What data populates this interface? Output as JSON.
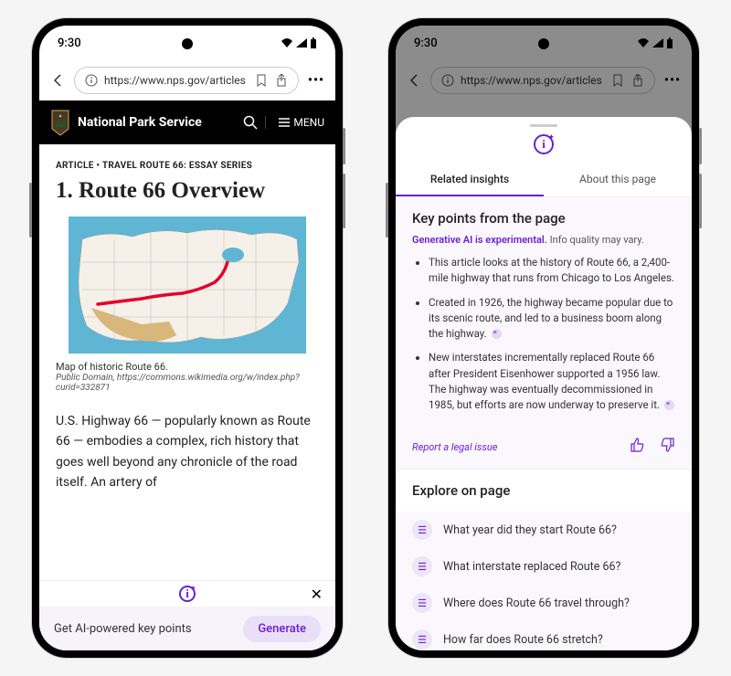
{
  "status": {
    "time": "9:30"
  },
  "browser": {
    "url": "https://www.nps.gov/articles",
    "menu_dots": "•••"
  },
  "nps": {
    "title": "National Park Service",
    "menu_label": "MENU"
  },
  "article": {
    "eyebrow": "ARTICLE • TRAVEL ROUTE 66: ESSAY SERIES",
    "headline": "1. Route 66 Overview",
    "caption": "Map of historic Route 66.",
    "caption_sub": "Public Domain, https://commons.wikimedia.org/w/index.php?curid=332871",
    "body": "U.S. Highway 66 — popularly known as Route 66 — embodies a complex, rich history that goes well beyond any chronicle of the road itself. An artery of"
  },
  "ai_bar": {
    "prompt": "Get AI-powered key points",
    "generate": "Generate"
  },
  "sheet": {
    "tabs": {
      "insights": "Related insights",
      "about": "About this page"
    },
    "key_points_title": "Key points from the page",
    "disclaimer_bold": "Generative AI is experimental.",
    "disclaimer_rest": " Info quality may vary.",
    "bullets": [
      "This article looks at the history of Route 66, a 2,400-mile highway that runs from Chicago to Los Angeles.",
      "Created in 1926, the highway became popular due to its scenic route, and led to a business boom along the highway.",
      "New interstates incrementally replaced Route 66 after President Eisenhower supported a 1956 law. The highway was eventually decommissioned in 1985, but efforts are now underway to preserve it."
    ],
    "report_link": "Report a legal issue",
    "explore_title": "Explore on page",
    "explore_items": [
      "What year did they start Route 66?",
      "What interstate replaced Route 66?",
      "Where does Route 66 travel through?",
      "How far does Route 66 stretch?"
    ]
  }
}
